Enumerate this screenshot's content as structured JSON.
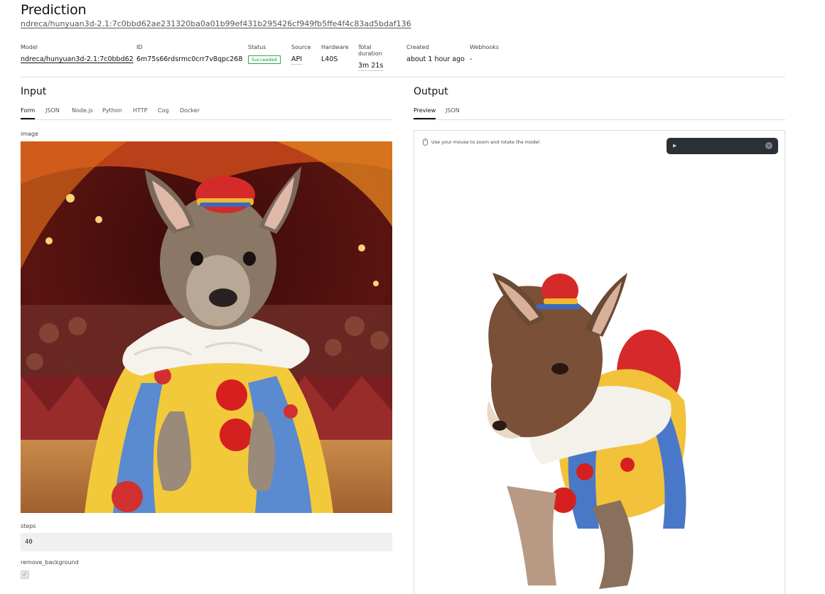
{
  "header": {
    "title": "Prediction",
    "version_link": "ndreca/hunyuan3d-2.1:7c0bbd62ae231320ba0a01b99ef431b295426cf949fb5ffe4f4c83ad5bdaf136"
  },
  "meta": {
    "model": {
      "label": "Model",
      "value": "ndreca/hunyuan3d-2.1:7c0bbd62"
    },
    "id": {
      "label": "ID",
      "value": "6m75s66rdsrmc0crr7v8qpc268"
    },
    "status": {
      "label": "Status",
      "value": "Succeeded"
    },
    "source": {
      "label": "Source",
      "value": "API"
    },
    "hardware": {
      "label": "Hardware",
      "value": "L40S"
    },
    "duration": {
      "label": "Total duration",
      "value": "3m 21s"
    },
    "created": {
      "label": "Created",
      "value": "about 1 hour ago"
    },
    "webhooks": {
      "label": "Webhooks",
      "value": "-"
    }
  },
  "input": {
    "title": "Input",
    "tabs": [
      "Form",
      "JSON",
      "Node.js",
      "Python",
      "HTTP",
      "Cog",
      "Docker"
    ],
    "active_tab": "Form",
    "image_label": "image",
    "steps_label": "steps",
    "steps_value": "40",
    "remove_background_label": "remove_background",
    "remove_background_checked": true
  },
  "output": {
    "title": "Output",
    "tabs": [
      "Preview",
      "JSON"
    ],
    "active_tab": "Preview",
    "hint": "Use your mouse to zoom and rotate the model"
  },
  "colors": {
    "status_green": "#2ea44f",
    "player_bg": "#2b2f36",
    "input_bg": "#f0f0f0"
  }
}
